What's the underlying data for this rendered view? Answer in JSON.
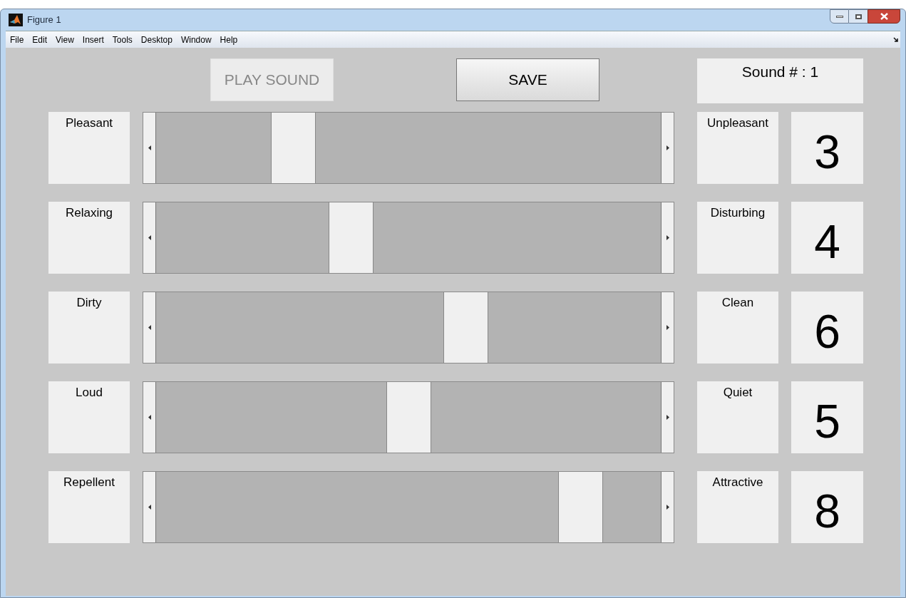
{
  "window": {
    "title": "Figure 1"
  },
  "menu": [
    "File",
    "Edit",
    "View",
    "Insert",
    "Tools",
    "Desktop",
    "Window",
    "Help"
  ],
  "buttons": [
    {
      "label": "PLAY SOUND",
      "disabled": true
    },
    {
      "label": "SAVE",
      "disabled": false
    }
  ],
  "sound_number": "Sound # : 1",
  "scales": [
    {
      "left": "Pleasant",
      "right": "Unpleasant",
      "level": 0.25,
      "value": "3"
    },
    {
      "left": "Relaxing",
      "right": "Disturbing",
      "level": 0.375,
      "value": "4"
    },
    {
      "left": "Dirty",
      "right": "Clean",
      "level": 0.625,
      "value": "6"
    },
    {
      "left": "Loud",
      "right": "Quiet",
      "level": 0.5,
      "value": "5"
    },
    {
      "left": "Repellent",
      "right": "Attractive",
      "level": 0.875,
      "value": "8"
    }
  ]
}
